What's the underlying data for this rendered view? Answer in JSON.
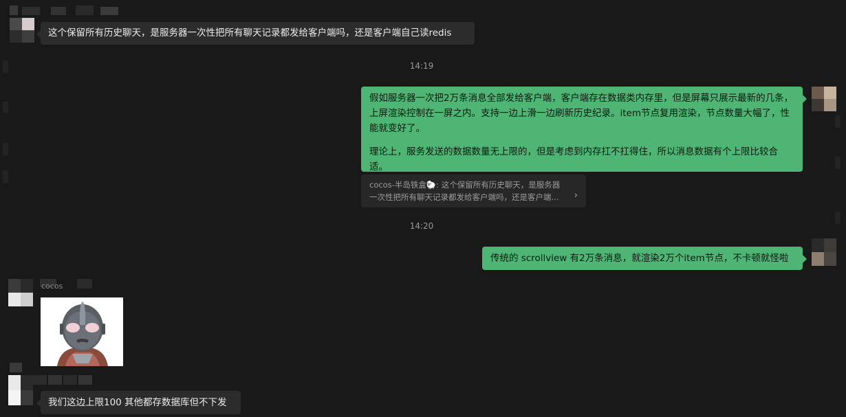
{
  "messages": [
    {
      "id": "m1",
      "direction": "in",
      "text": "这个保留所有历史聊天，是服务器一次性把所有聊天记录都发给客户端吗，还是客户端自己读redis"
    },
    {
      "id": "t1",
      "timestamp": "14:19"
    },
    {
      "id": "m2",
      "direction": "out",
      "paragraphs": [
        "假如服务器一次把2万条消息全部发给客户端，客户端存在数据类内存里，但是屏幕只展示最新的几条，上屏渲染控制在一屏之内。支持一边上滑一边刷新历史纪录。item节点复用渲染，节点数量大幅了，性能就变好了。",
        "理论上，服务发送的数据数量无上限的，但是考虑到内存扛不扛得住，所以消息数据有个上限比较合适。"
      ]
    },
    {
      "id": "q1",
      "quote": {
        "line1": "cocos-半岛铁盒🐑: 这个保留所有历史聊天，是服务器",
        "line2": "一次性把所有聊天记录都发给客户端吗，还是客户端..."
      }
    },
    {
      "id": "t2",
      "timestamp": "14:20"
    },
    {
      "id": "m3",
      "direction": "out",
      "text": "传统的 scrollview 有2万条消息，就渲染2万个item节点，不卡顿就怪啦"
    },
    {
      "id": "m4",
      "direction": "in",
      "sender": "cocos",
      "type": "sticker",
      "sticker": "ultraman-sticker"
    },
    {
      "id": "m5",
      "direction": "in",
      "text": "我们这边上限100 其他都存数据库但不下发"
    }
  ],
  "colors": {
    "background": "#191919",
    "incoming_bubble": "#2c2c2c",
    "outgoing_bubble": "#4eb574",
    "timestamp": "#9a9a9a"
  },
  "icons": {
    "quote_chevron": "chevron-right-icon"
  }
}
